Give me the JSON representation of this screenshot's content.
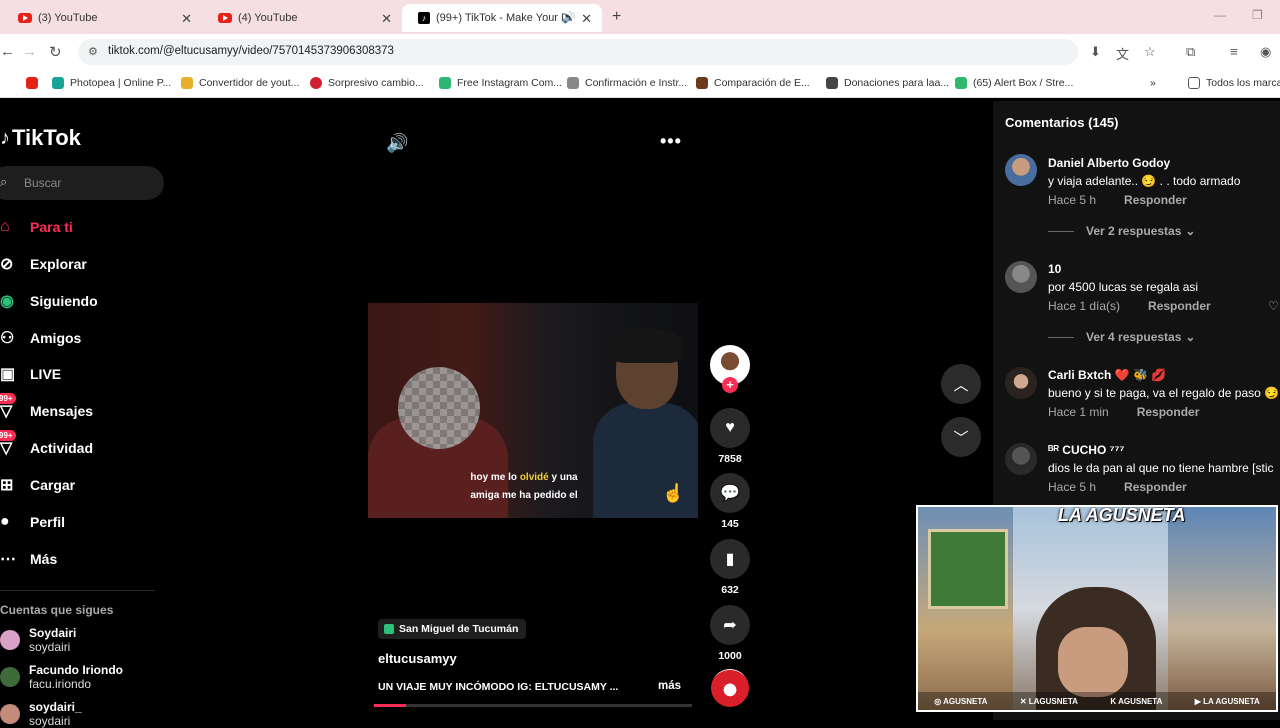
{
  "browser": {
    "tabs": [
      {
        "title": "(3) YouTube",
        "icon": "youtube-icon"
      },
      {
        "title": "(4) YouTube",
        "icon": "youtube-icon"
      },
      {
        "title": "(99+) TikTok - Make Your Da",
        "icon": "tiktok-icon"
      }
    ],
    "url": "tiktok.com/@eltucusamyy/video/7570145373906308373",
    "bookmarks": [
      {
        "label": "Photopea | Online P...",
        "color": "#18a497"
      },
      {
        "label": "Convertidor de yout...",
        "color": "#e8b02a"
      },
      {
        "label": "Sorpresivo cambio...",
        "color": "#d02030"
      },
      {
        "label": "Free Instagram Com...",
        "color": "#2bb673"
      },
      {
        "label": "Confirmación e Instr...",
        "color": "#888888"
      },
      {
        "label": "Comparación de E...",
        "color": "#6b3a1a"
      },
      {
        "label": "Donaciones para laa...",
        "color": "#444444"
      },
      {
        "label": "(65) Alert Box / Stre...",
        "color": "#2fb86e"
      }
    ],
    "bookmarks_folder": "Todos los marca"
  },
  "sidebar": {
    "logo": "TikTok",
    "search_placeholder": "Buscar",
    "nav": [
      {
        "label": "Para ti",
        "icon": "home-icon",
        "active": true
      },
      {
        "label": "Explorar",
        "icon": "compass-icon"
      },
      {
        "label": "Siguiendo",
        "icon": "following-icon"
      },
      {
        "label": "Amigos",
        "icon": "friends-icon"
      },
      {
        "label": "LIVE",
        "icon": "live-icon"
      },
      {
        "label": "Mensajes",
        "icon": "messages-icon",
        "badge": "99+"
      },
      {
        "label": "Actividad",
        "icon": "activity-icon",
        "badge": "99+"
      },
      {
        "label": "Cargar",
        "icon": "upload-icon"
      },
      {
        "label": "Perfil",
        "icon": "profile-icon"
      },
      {
        "label": "Más",
        "icon": "more-icon"
      }
    ],
    "following_title": "Cuentas que sigues",
    "following": [
      {
        "name": "Soydairi",
        "handle": "soydairi"
      },
      {
        "name": "Facundo Iriondo",
        "handle": "facu.iriondo"
      },
      {
        "name": "soydairi_",
        "handle": "soydairi"
      }
    ]
  },
  "video": {
    "subtitle_pre": "hoy me lo ",
    "subtitle_highlight": "olvidé",
    "subtitle_post": " y una amiga me ha pedido el",
    "location": "San Miguel de Tucumán",
    "author": "eltucusamyy",
    "caption": "UN VIAJE MUY INCÓMODO IG: ELTUCUSAMY ...",
    "more_label": "más",
    "progress": 0.1
  },
  "actions": {
    "likes": "7858",
    "comments": "145",
    "saves": "632",
    "shares": "1000"
  },
  "comments_panel": {
    "title": "Comentarios (145)",
    "items": [
      {
        "name": "Daniel Alberto Godoy",
        "text": "y viaja adelante.. 😏 . . todo armado",
        "time": "Hace 5 h",
        "reply": "Responder",
        "views": "Ver 2 respuestas"
      },
      {
        "name": "10",
        "text": "por 4500 lucas se regala asi",
        "time": "Hace 1 día(s)",
        "reply": "Responder",
        "views": "Ver 4 respuestas"
      },
      {
        "name": "Carli Bxtch ❤️ 🐝 💋",
        "text": "bueno y si te paga, va el regalo de paso 😏",
        "time": "Hace 1 min",
        "reply": "Responder"
      },
      {
        "name": "ᴮᴿ  CUCHO  ⁷⁷⁷",
        "text": "dios le da pan al que no tiene hambre [stic",
        "time": "Hace 5 h",
        "reply": "Responder"
      }
    ]
  },
  "webcam": {
    "logo": "LA AGUSNETA",
    "footer": [
      "AGUSNETA",
      "LAGUSNETA",
      "AGUSNETA",
      "LA AGUSNETA"
    ]
  }
}
